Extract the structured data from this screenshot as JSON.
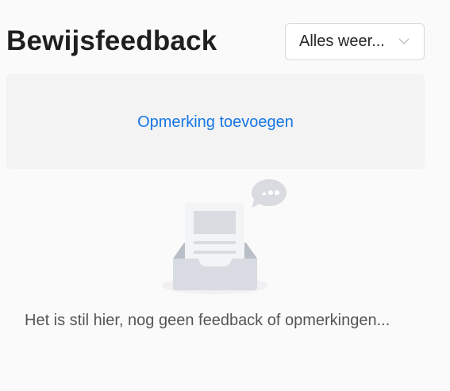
{
  "header": {
    "title": "Bewijsfeedback",
    "filter": {
      "selected_label": "Alles weer..."
    }
  },
  "actions": {
    "add_comment_label": "Opmerking toevoegen"
  },
  "empty_state": {
    "icon": "empty-inbox-icon",
    "message": "Het is stil hier, nog geen feedback of opmerkingen..."
  },
  "colors": {
    "link": "#1677e6",
    "title": "#1f1f1f",
    "box_background": "#f3f3f3",
    "page_background": "#fafafa"
  }
}
